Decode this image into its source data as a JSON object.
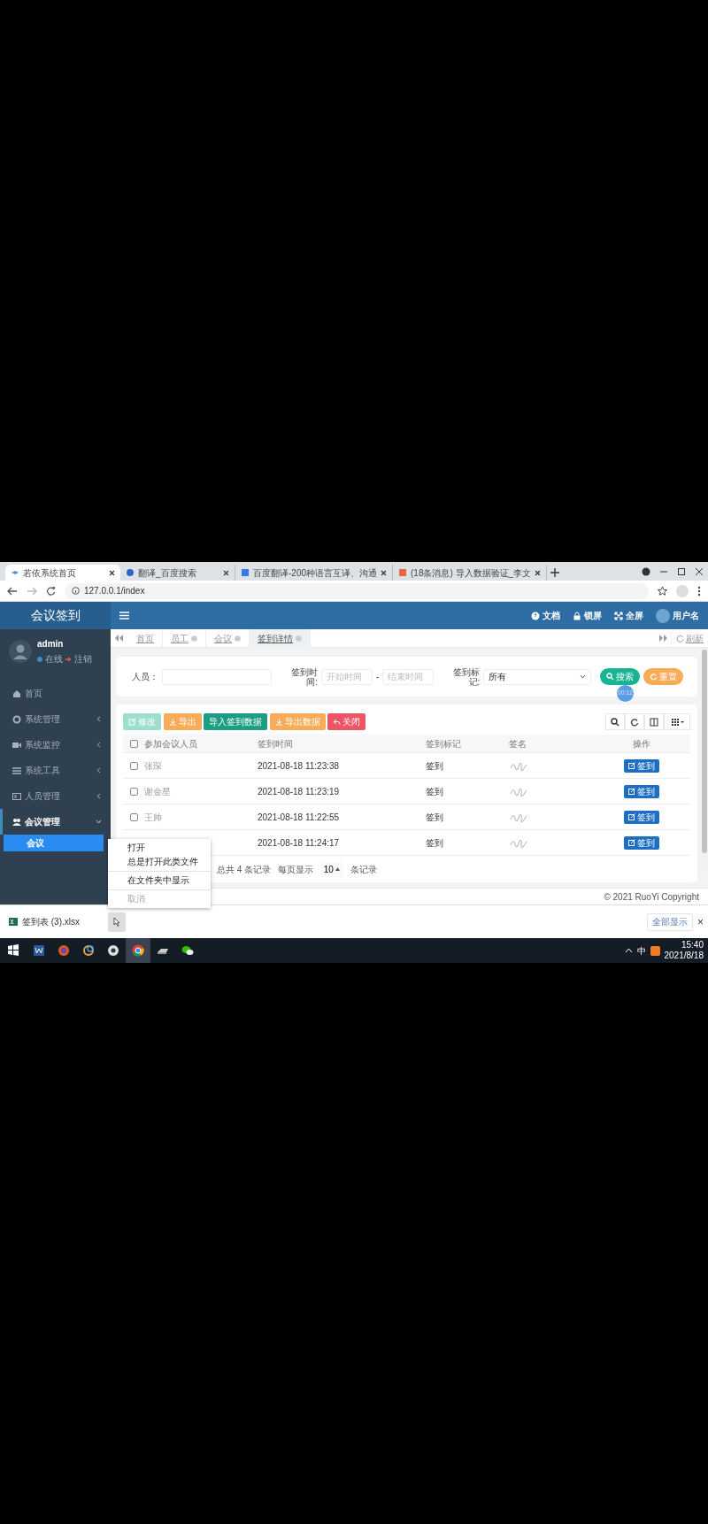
{
  "browser": {
    "tabs": [
      {
        "title": "若依系统首页",
        "selected": true
      },
      {
        "title": "翻译_百度搜索",
        "selected": false
      },
      {
        "title": "百度翻译-200种语言互译、沟通",
        "selected": false
      },
      {
        "title": "(18条消息) 导入数据验证_李文",
        "selected": false
      }
    ],
    "address": "127.0.0.1/index"
  },
  "header": {
    "brand": "会议签到",
    "links": [
      {
        "label": "文档",
        "kind": "doc"
      },
      {
        "label": "锁屏",
        "kind": "lock"
      },
      {
        "label": "全屏",
        "kind": "fullscreen"
      }
    ],
    "username": "用户名"
  },
  "sidebar": {
    "user": "admin",
    "status": "在线",
    "logout": "注销",
    "items": [
      {
        "label": "首页",
        "kind": "link"
      },
      {
        "label": "系统管理",
        "kind": "menu",
        "expanded": false
      },
      {
        "label": "系统监控",
        "kind": "menu",
        "expanded": false
      },
      {
        "label": "系统工具",
        "kind": "menu",
        "expanded": false
      },
      {
        "label": "人员管理",
        "kind": "menu",
        "expanded": false
      },
      {
        "label": "会议管理",
        "kind": "menu",
        "expanded": true,
        "children": [
          {
            "label": "会议",
            "selected": true
          }
        ]
      }
    ]
  },
  "page_tabs": {
    "tabs": [
      {
        "label": "首页",
        "closable": false,
        "selected": false
      },
      {
        "label": "员工",
        "closable": true,
        "selected": false
      },
      {
        "label": "会议",
        "closable": true,
        "selected": false
      },
      {
        "label": "签到详情",
        "closable": true,
        "selected": true
      }
    ],
    "refresh": "刷新"
  },
  "search": {
    "fields": [
      {
        "kind": "text",
        "label": "人员："
      },
      {
        "kind": "daterange",
        "label": "签到时间:",
        "placeholder": "开始时间",
        "separator": "-",
        "placeholder_end": "结束时间"
      },
      {
        "kind": "select",
        "label": "签到标记:",
        "value": "所有"
      }
    ],
    "buttons": [
      {
        "label": "搜索",
        "kind": "search"
      },
      {
        "label": "重置",
        "kind": "reset"
      }
    ],
    "recorder_badge": "00:12"
  },
  "toolbar": [
    {
      "label": "修改",
      "kind": "edit",
      "disabled": true
    },
    {
      "label": "导出",
      "kind": "export",
      "disabled": false
    },
    {
      "label": "导入签到数据",
      "kind": "import",
      "disabled": false
    },
    {
      "label": "导出数据",
      "kind": "export",
      "disabled": false
    },
    {
      "label": "关闭",
      "kind": "close",
      "disabled": false
    }
  ],
  "table": {
    "select_all_checked": false,
    "columns": [
      "参加会议人员",
      "签到时间",
      "签到标记",
      "签名",
      "操作"
    ],
    "rows": [
      {
        "checked": false,
        "name": "张琛",
        "time": "2021-08-18 11:23:38",
        "mark": "签到",
        "action": "签到"
      },
      {
        "checked": false,
        "name": "谢金星",
        "time": "2021-08-18 11:23:19",
        "mark": "签到",
        "action": "签到"
      },
      {
        "checked": false,
        "name": "王帅",
        "time": "2021-08-18 11:22:55",
        "mark": "签到",
        "action": "签到"
      },
      {
        "time": "2021-08-18 11:24:17",
        "mark": "签到",
        "action": "签到"
      }
    ]
  },
  "pagination": {
    "total": "总共 4 条记录",
    "per_page": "每页显示",
    "page_size": "10",
    "suffix": "条记录"
  },
  "footer": "© 2021 RuoYi Copyright",
  "download_bar": {
    "file": "签到表 (3).xlsx",
    "show_all": "全部显示",
    "close": "×"
  },
  "context_menu": [
    [
      {
        "label": "打开",
        "disabled": false
      },
      {
        "label": "总是打开此类文件",
        "disabled": false
      }
    ],
    [
      {
        "label": "在文件夹中显示",
        "disabled": false
      }
    ],
    [
      {
        "label": "取消",
        "disabled": true
      }
    ]
  ],
  "taskbar": {
    "ime": "中",
    "time": "15:40",
    "date": "2021/8/18"
  }
}
